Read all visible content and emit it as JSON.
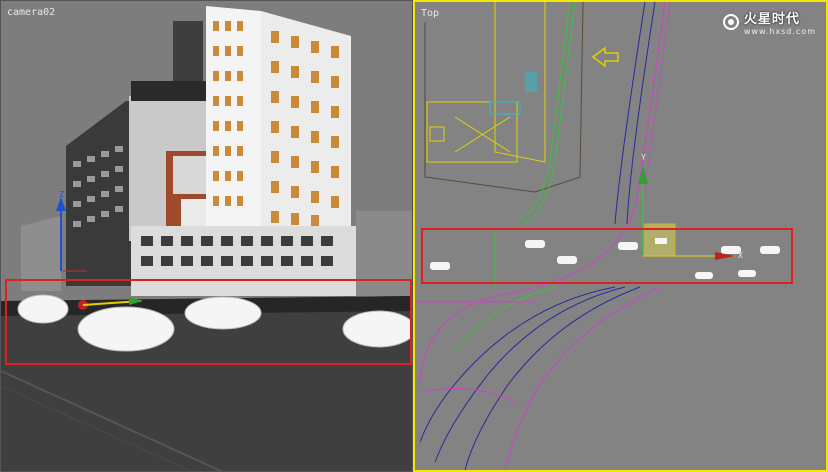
{
  "viewports": {
    "left": {
      "label": "camera02"
    },
    "right": {
      "label": "Top"
    }
  },
  "gizmo": {
    "axis_x": "X",
    "axis_y": "Y",
    "axis_z": "Z"
  },
  "watermark": {
    "brand": "火星时代",
    "url": "www.hxsd.com"
  },
  "colors": {
    "highlight": "#e02020",
    "active_border": "#f4e600",
    "road_magenta": "#d040c8",
    "road_blue": "#2a2a9a",
    "spline_green": "#3cc040",
    "wire_yellow": "#e0d000"
  }
}
